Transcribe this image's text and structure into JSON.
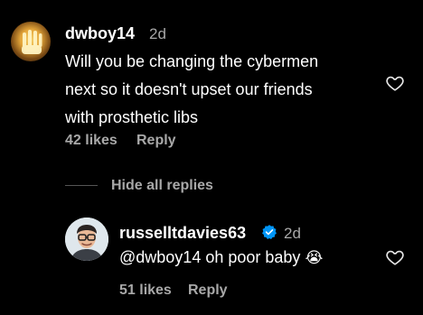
{
  "comment": {
    "username": "dwboy14",
    "age": "2d",
    "text_lines": [
      "Will you be changing the cybermen",
      "next so it doesn't upset our friends",
      "with prosthetic libs"
    ],
    "likes": "42 likes",
    "reply_label": "Reply",
    "hide_replies_label": "Hide all replies"
  },
  "reply": {
    "username": "russelltdavies63",
    "age": "2d",
    "text": "@dwboy14 oh poor baby",
    "emoji": "😭",
    "likes": "51 likes",
    "reply_label": "Reply"
  },
  "icons": {
    "like": "heart-outline-icon",
    "verified": "verified-badge-icon"
  },
  "colors": {
    "background": "#000000",
    "text": "#ffffff",
    "muted": "#a8a8a8",
    "verified": "#0095f6"
  }
}
